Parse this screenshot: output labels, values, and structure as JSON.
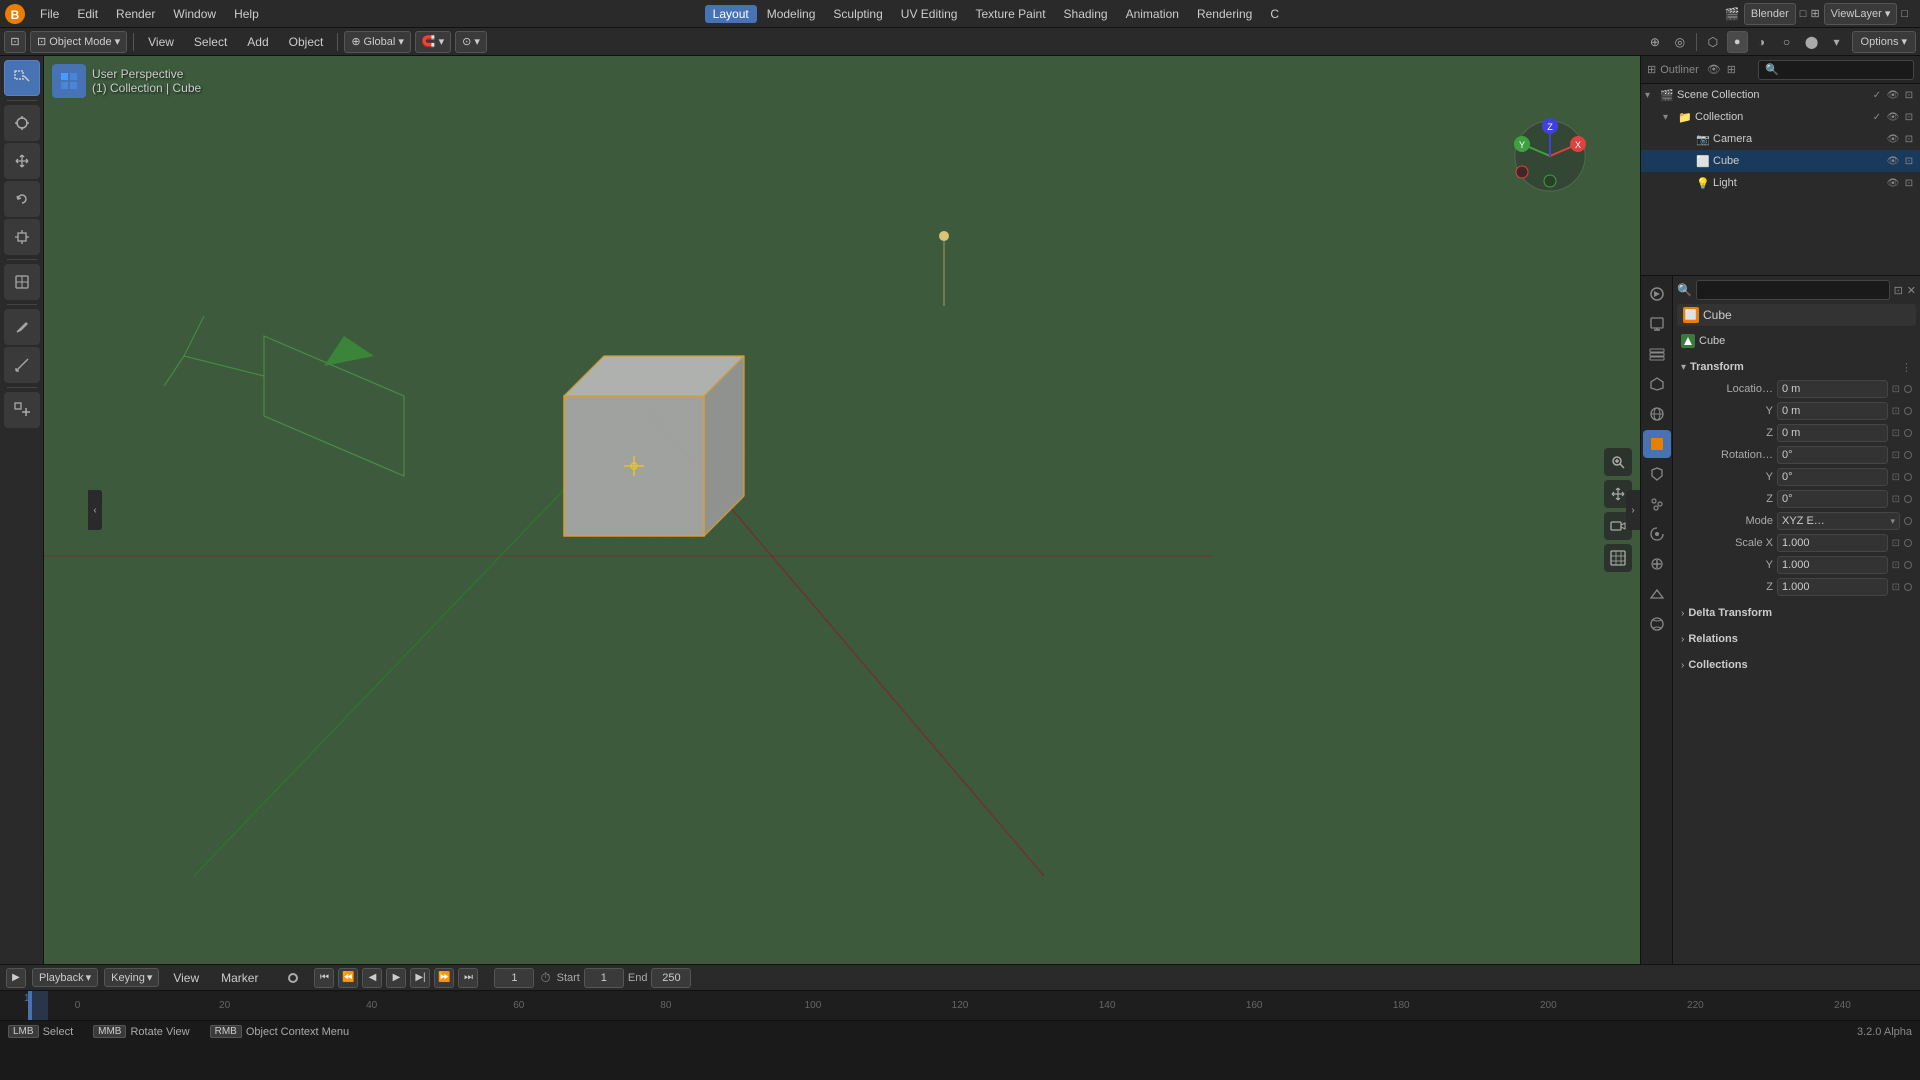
{
  "app": {
    "title": "Blender",
    "version": "3.2.0 Alpha"
  },
  "topMenu": {
    "items": [
      "File",
      "Edit",
      "Render",
      "Window",
      "Help"
    ],
    "workspaces": [
      "Layout",
      "Modeling",
      "Sculpting",
      "UV Editing",
      "Texture Paint",
      "Shading",
      "Animation",
      "Rendering"
    ]
  },
  "toolbar": {
    "mode": "Object Mode",
    "view": "View",
    "select": "Select",
    "add": "Add",
    "object": "Object",
    "transform": "Global",
    "options_label": "Options"
  },
  "viewport": {
    "label": "User Perspective",
    "sublabel": "(1) Collection | Cube"
  },
  "outliner": {
    "scene_collection": "Scene Collection",
    "items": [
      {
        "label": "Collection",
        "type": "collection",
        "indent": 1,
        "expanded": true
      },
      {
        "label": "Camera",
        "type": "camera",
        "indent": 2
      },
      {
        "label": "Cube",
        "type": "mesh",
        "indent": 2,
        "selected": true
      },
      {
        "label": "Light",
        "type": "light",
        "indent": 2
      }
    ]
  },
  "properties": {
    "object_name": "Cube",
    "data_name": "Cube",
    "transform": {
      "title": "Transform",
      "location": {
        "x": "0 m",
        "y": "0 m",
        "z": "0 m"
      },
      "rotation": {
        "x": "0°",
        "y": "0°",
        "z": "0°"
      },
      "mode": "XYZ E…",
      "scale": {
        "x": "1.000",
        "y": "1.000",
        "z": "1.000"
      }
    },
    "delta_transform": {
      "title": "Delta Transform",
      "collapsed": true
    },
    "relations": {
      "title": "Relations",
      "collapsed": true
    },
    "collections": {
      "title": "Collections",
      "collapsed": true
    }
  },
  "timeline": {
    "current_frame": "1",
    "start_frame": "1",
    "end_frame": "250",
    "marks": [
      "0",
      "20",
      "40",
      "60",
      "80",
      "100",
      "120",
      "140",
      "160",
      "180",
      "200",
      "220",
      "240"
    ],
    "playback_label": "Playback",
    "keying_label": "Keying",
    "view_label": "View",
    "marker_label": "Marker"
  },
  "statusBar": {
    "select_label": "Select",
    "rotate_label": "Rotate View",
    "context_label": "Object Context Menu"
  },
  "colors": {
    "accent": "#4772b3",
    "bg_dark": "#1a1a1a",
    "bg_mid": "#2a2a2a",
    "bg_panel": "#252525",
    "viewport_bg": "#3d5a3d",
    "selected": "#1a3a5c",
    "orange": "#e87f00"
  }
}
